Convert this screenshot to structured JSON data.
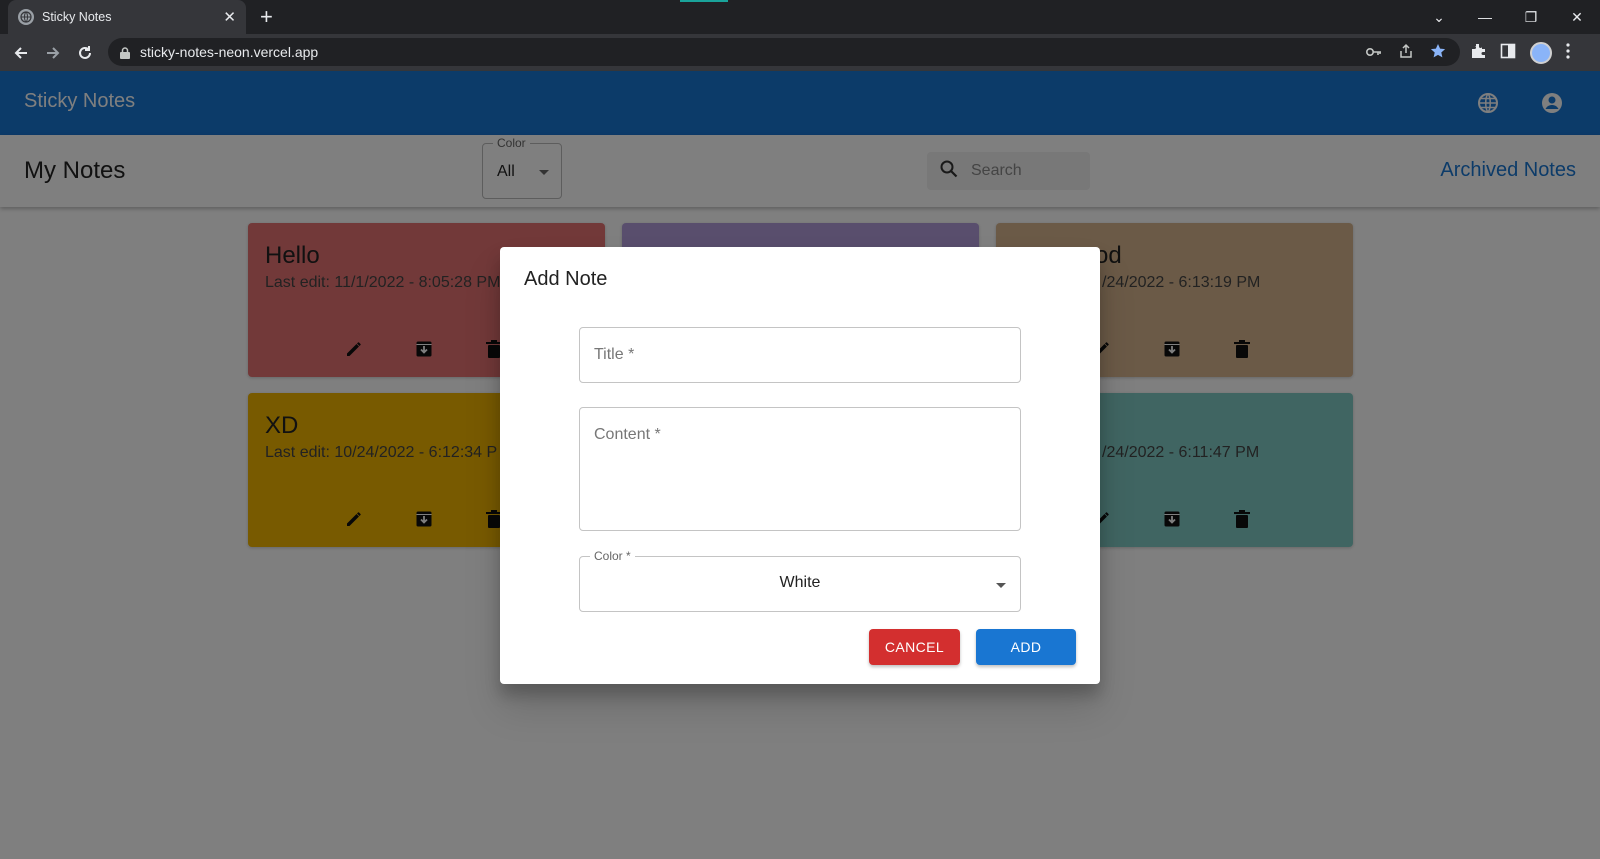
{
  "browser": {
    "tab_title": "Sticky Notes",
    "tab_close": "✕",
    "new_tab": "+",
    "url": "sticky-notes-neon.vercel.app",
    "window_controls": {
      "tabs_menu": "⌄",
      "minimize": "—",
      "restore": "❐",
      "close": "✕"
    }
  },
  "appbar": {
    "brand": "Sticky Notes"
  },
  "toolbar": {
    "heading": "My Notes",
    "color_filter": {
      "label": "Color",
      "value": "All"
    },
    "search": {
      "placeholder": "Search"
    },
    "archived_link": "Archived Notes"
  },
  "notes": [
    {
      "title": "Hello",
      "last_edit": "Last edit: 11/1/2022 - 8:05:28 PM",
      "color": "#e57373"
    },
    {
      "title": "",
      "last_edit": "",
      "color": "#b39ddb"
    },
    {
      "title": "od",
      "last_edit": "/24/2022 - 6:13:19 PM",
      "color": "#d7b58e"
    },
    {
      "title": "XD",
      "last_edit": "Last edit: 10/24/2022 - 6:12:34 P",
      "color": "#f0b400"
    },
    {
      "title": "",
      "last_edit": "/24/2022 - 6:11:47 PM",
      "color": "#80cbc4"
    }
  ],
  "dialog": {
    "title": "Add Note",
    "title_field": {
      "placeholder": "Title *"
    },
    "content_field": {
      "placeholder": "Content *"
    },
    "color_field": {
      "label": "Color *",
      "value": "White"
    },
    "cancel_label": "CANCEL",
    "add_label": "ADD"
  },
  "colors": {
    "appbar": "#1976d2",
    "link": "#1976d2",
    "cancel_button": "#d32f2f",
    "add_button": "#1976d2"
  },
  "icons": [
    "globe-icon",
    "account-circle-icon",
    "search-icon",
    "edit-icon",
    "archive-icon",
    "delete-icon",
    "key-icon",
    "share-icon",
    "star-icon",
    "extensions-icon",
    "sidepanel-icon",
    "menu-icon"
  ]
}
